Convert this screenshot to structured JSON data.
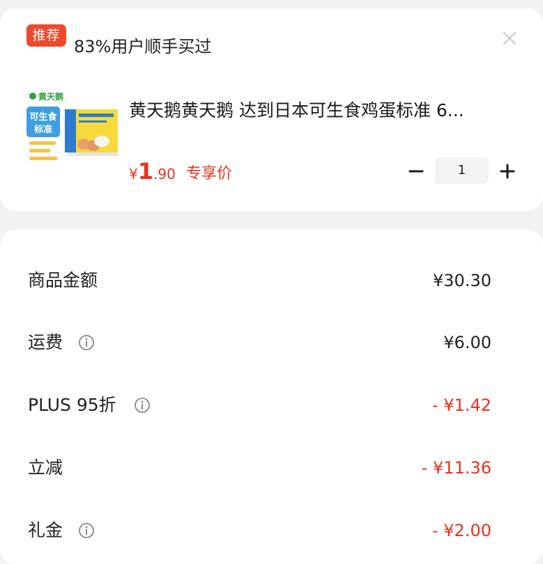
{
  "recommend": {
    "badge": "推荐",
    "text": "83%用户顺手买过"
  },
  "product": {
    "title": "黄天鹅黄天鹅 达到日本可生食鸡蛋标准 6...",
    "price_currency": "¥",
    "price_integer": "1",
    "price_decimal": ".90",
    "price_label": "专享价",
    "quantity": "1",
    "image_text": {
      "brand": "黄天鹅",
      "line1": "可生食",
      "line2": "标准"
    }
  },
  "summary": {
    "rows": [
      {
        "label": "商品金额",
        "value": "¥30.30",
        "has_info": false,
        "negative": false
      },
      {
        "label": "运费",
        "value": "¥6.00",
        "has_info": true,
        "negative": false
      },
      {
        "label": "PLUS 95折",
        "value": "- ¥1.42",
        "has_info": true,
        "negative": true
      },
      {
        "label": "立减",
        "value": "- ¥11.36",
        "has_info": false,
        "negative": true
      },
      {
        "label": "礼金",
        "value": "- ¥2.00",
        "has_info": true,
        "negative": true
      }
    ]
  },
  "colors": {
    "accent_red": "#e8321f",
    "badge_red": "#ec4a2c",
    "background": "#f2f2f2",
    "card": "#ffffff"
  },
  "icons": {
    "close": "close-icon",
    "minus": "minus-icon",
    "plus": "plus-icon",
    "info": "info-icon"
  }
}
